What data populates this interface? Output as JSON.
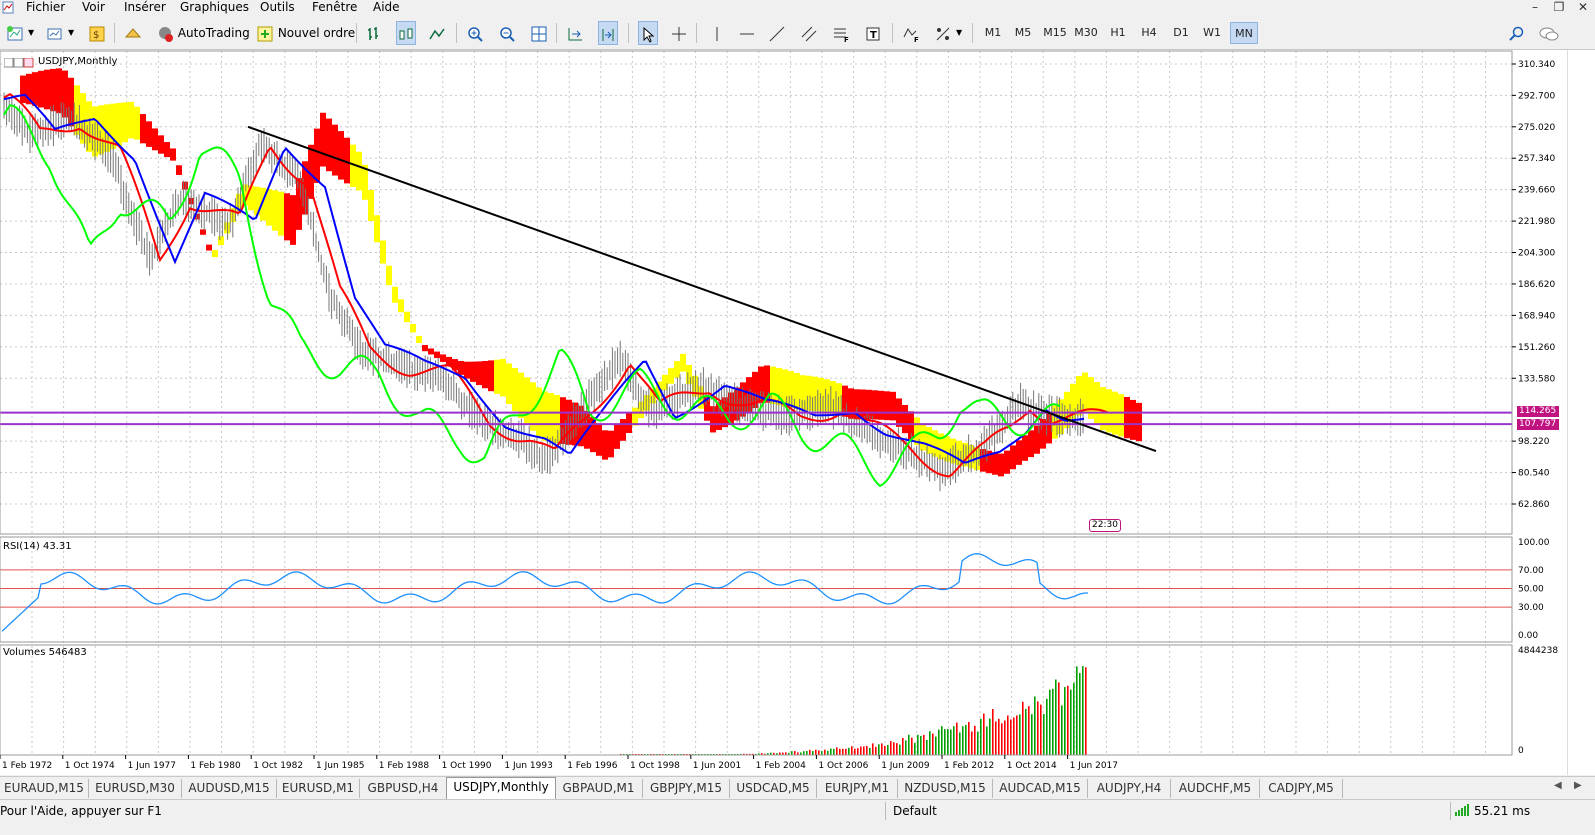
{
  "menu": [
    "Fichier",
    "Voir",
    "Insérer",
    "Graphiques",
    "Outils",
    "Fenêtre",
    "Aide"
  ],
  "window_controls": [
    "–",
    "❐",
    "✕"
  ],
  "toolbar": {
    "autotrading_label": "AutoTrading",
    "new_order_label": "Nouvel ordre",
    "timeframes": [
      "M1",
      "M5",
      "M15",
      "M30",
      "H1",
      "H4",
      "D1",
      "W1",
      "MN"
    ],
    "active_timeframe": "MN"
  },
  "chart": {
    "title": "USDJPY,Monthly",
    "price_levels": [
      "310.340",
      "292.700",
      "275.020",
      "257.340",
      "239.660",
      "221.980",
      "204.300",
      "186.620",
      "168.940",
      "151.260",
      "133.580",
      "98.220",
      "80.540",
      "62.860"
    ],
    "price_tags": [
      {
        "label": "114.265",
        "color": "#c0137f"
      },
      {
        "label": "107.797",
        "color": "#c0137f"
      }
    ],
    "time_box": "22:30",
    "rsi_label": "RSI(14) 43.31",
    "rsi_levels": [
      "100.00",
      "70.00",
      "50.00",
      "30.00",
      "0.00"
    ],
    "volumes_label": "Volumes 546483",
    "volume_levels": [
      "4844238",
      "0"
    ],
    "time_labels": [
      "1 Feb 1972",
      "1 Oct 1974",
      "1 Jun 1977",
      "1 Feb 1980",
      "1 Oct 1982",
      "1 Jun 1985",
      "1 Feb 1988",
      "1 Oct 1990",
      "1 Jun 1993",
      "1 Feb 1996",
      "1 Oct 1998",
      "1 Jun 2001",
      "1 Feb 2004",
      "1 Oct 2006",
      "1 Jun 2009",
      "1 Feb 2012",
      "1 Oct 2014",
      "1 Jun 2017"
    ],
    "colors": {
      "background": "#ffffff",
      "price_line": "#a0a0a0",
      "tenkan": "#ff0000",
      "kijun": "#0000ff",
      "chikou": "#00ff00",
      "cloud_bear": "#ff0000",
      "cloud_bull": "#ffff00",
      "rsi_line": "#1e90ff",
      "level_line": "#9932cc",
      "trend_line": "#000000",
      "volume_up": "#00a000",
      "volume_down": "#ff0000"
    }
  },
  "tabs": [
    "EURAUD,M15",
    "EURUSD,M30",
    "AUDUSD,M15",
    "EURUSD,M1",
    "GBPUSD,H4",
    "USDJPY,Monthly",
    "GBPAUD,M1",
    "GBPJPY,M15",
    "USDCAD,M5",
    "EURJPY,M1",
    "NZDUSD,M15",
    "AUDCAD,M15",
    "AUDJPY,H4",
    "AUDCHF,M5",
    "CADJPY,M5"
  ],
  "active_tab": "USDJPY,Monthly",
  "status": {
    "help": "Pour l'Aide, appuyer sur F1",
    "profile": "Default",
    "ping": "55.21 ms"
  }
}
